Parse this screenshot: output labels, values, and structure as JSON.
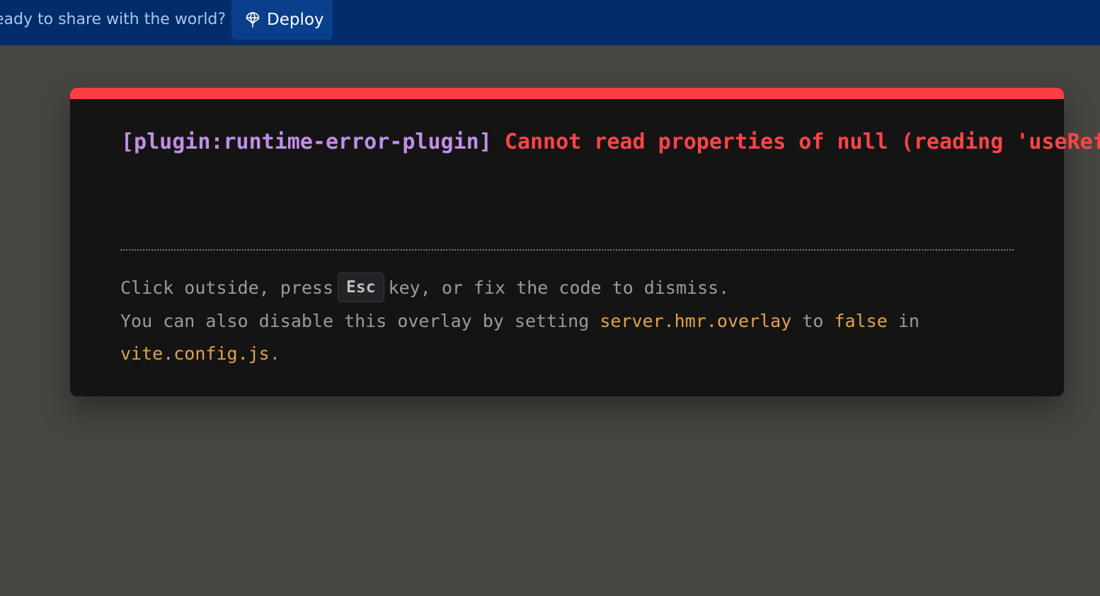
{
  "topbar": {
    "prompt_text": "eady to share with the world?",
    "deploy_label": "Deploy",
    "deploy_icon": "parachute-icon"
  },
  "overlay": {
    "plugin": "[plugin:runtime-error-plugin]",
    "error_message": "Cannot read properties of null (reading 'useRef')",
    "tip_line1_a": "Click outside, press",
    "tip_key": "Esc",
    "tip_line1_b": "key, or fix the code to dismiss.",
    "tip_line2_a": "You can also disable this overlay by setting",
    "tip_code1": "server.hmr.overlay",
    "tip_line2_b": "to",
    "tip_code2": "false",
    "tip_line2_c": "in",
    "tip_code3": "vite.config.js",
    "tip_end": "."
  },
  "colors": {
    "topbar_bg": "#022d6a",
    "deploy_bg": "#0a3f8c",
    "error_red": "#ff4448",
    "plugin_purple": "#c28ee8",
    "code_orange": "#e3a24a",
    "backdrop": "#474541"
  }
}
